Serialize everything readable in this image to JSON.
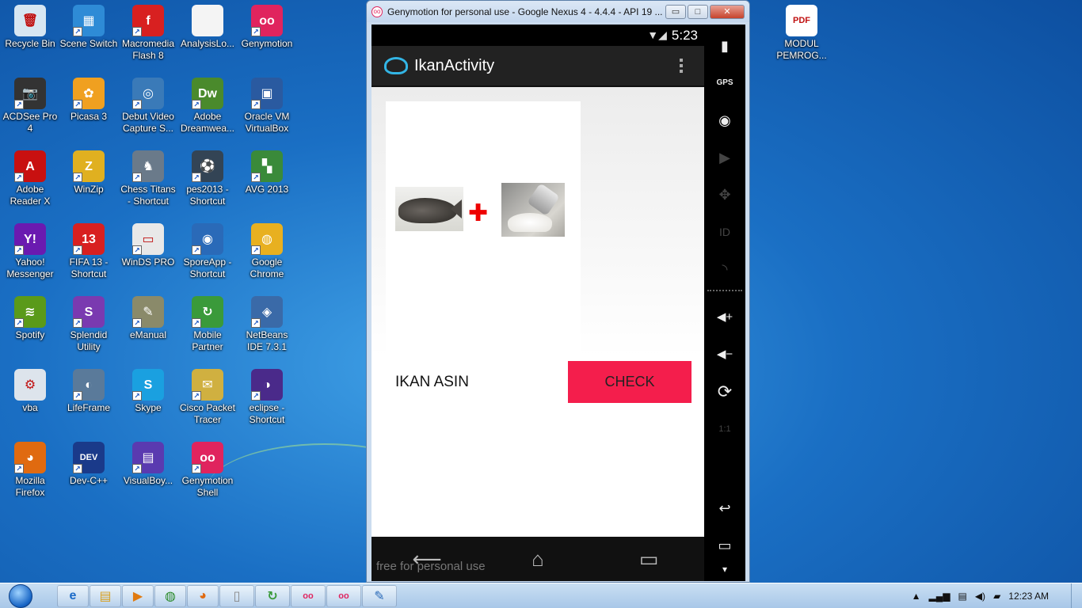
{
  "desktop": {
    "icons": [
      {
        "id": "recycle-bin",
        "label": "Recycle Bin",
        "color": "#d6e6f2",
        "glyph": "🗑",
        "shortcut": false
      },
      {
        "id": "scene-switch",
        "label": "Scene Switch",
        "color": "#2e8bd6",
        "glyph": "▦",
        "shortcut": true
      },
      {
        "id": "macromedia-flash-8",
        "label": "Macromedia Flash 8",
        "color": "#d82020",
        "glyph": "f",
        "shortcut": true
      },
      {
        "id": "analysislo",
        "label": "AnalysisLo...",
        "color": "#f4f4f4",
        "glyph": "",
        "shortcut": false
      },
      {
        "id": "genymotion",
        "label": "Genymotion",
        "color": "#e0245e",
        "glyph": "oo",
        "shortcut": true
      },
      {
        "id": "acdsee-pro-4",
        "label": "ACDSee Pro 4",
        "color": "#333333",
        "glyph": "📷",
        "shortcut": true
      },
      {
        "id": "picasa-3",
        "label": "Picasa 3",
        "color": "#f0a020",
        "glyph": "✿",
        "shortcut": true
      },
      {
        "id": "debut-video",
        "label": "Debut Video Capture S...",
        "color": "#3a7ab8",
        "glyph": "◎",
        "shortcut": true
      },
      {
        "id": "adobe-dreamweaver",
        "label": "Adobe Dreamwea...",
        "color": "#4a8a2c",
        "glyph": "Dw",
        "shortcut": true
      },
      {
        "id": "oracle-vm-virtualbox",
        "label": "Oracle VM VirtualBox",
        "color": "#2a5aa0",
        "glyph": "▣",
        "shortcut": true
      },
      {
        "id": "adobe-reader-x",
        "label": "Adobe Reader X",
        "color": "#c81010",
        "glyph": "A",
        "shortcut": true
      },
      {
        "id": "winzip",
        "label": "WinZip",
        "color": "#e0b020",
        "glyph": "Z",
        "shortcut": true
      },
      {
        "id": "chess-titans",
        "label": "Chess Titans - Shortcut",
        "color": "#6a7a8a",
        "glyph": "♞",
        "shortcut": true
      },
      {
        "id": "pes2013",
        "label": "pes2013 - Shortcut",
        "color": "#334455",
        "glyph": "⚽",
        "shortcut": true
      },
      {
        "id": "avg-2013",
        "label": "AVG 2013",
        "color": "#3a8a3a",
        "glyph": "▚",
        "shortcut": true
      },
      {
        "id": "yahoo-messenger",
        "label": "Yahoo! Messenger",
        "color": "#6a1ab0",
        "glyph": "Y!",
        "shortcut": true
      },
      {
        "id": "fifa-13",
        "label": "FIFA 13 - Shortcut",
        "color": "#d82020",
        "glyph": "13",
        "shortcut": true
      },
      {
        "id": "winds-pro",
        "label": "WinDS PRO",
        "color": "#e8e8e8",
        "glyph": "▭",
        "shortcut": true
      },
      {
        "id": "sporeapp",
        "label": "SporeApp - Shortcut",
        "color": "#2a6ab8",
        "glyph": "◉",
        "shortcut": true
      },
      {
        "id": "google-chrome",
        "label": "Google Chrome",
        "color": "#e8b020",
        "glyph": "◍",
        "shortcut": true
      },
      {
        "id": "spotify",
        "label": "Spotify",
        "color": "#5a9a1a",
        "glyph": "≋",
        "shortcut": true
      },
      {
        "id": "splendid-utility",
        "label": "Splendid Utility",
        "color": "#7a3ab0",
        "glyph": "S",
        "shortcut": true
      },
      {
        "id": "emanual",
        "label": "eManual",
        "color": "#8a8a6a",
        "glyph": "✎",
        "shortcut": true
      },
      {
        "id": "mobile-partner",
        "label": "Mobile Partner",
        "color": "#3a9a3a",
        "glyph": "↻",
        "shortcut": true
      },
      {
        "id": "netbeans-ide",
        "label": "NetBeans IDE 7.3.1",
        "color": "#3a6aa8",
        "glyph": "◈",
        "shortcut": true
      },
      {
        "id": "vba",
        "label": "vba",
        "color": "#dde4ec",
        "glyph": "⚙",
        "shortcut": false
      },
      {
        "id": "lifeframe",
        "label": "LifeFrame",
        "color": "#5a7a9a",
        "glyph": "◐",
        "shortcut": true
      },
      {
        "id": "skype",
        "label": "Skype",
        "color": "#1aa0e0",
        "glyph": "S",
        "shortcut": true
      },
      {
        "id": "cisco-packet-tracer",
        "label": "Cisco Packet Tracer",
        "color": "#d0b040",
        "glyph": "✉",
        "shortcut": true
      },
      {
        "id": "eclipse",
        "label": "eclipse - Shortcut",
        "color": "#4a2a8a",
        "glyph": "◑",
        "shortcut": true
      },
      {
        "id": "mozilla-firefox",
        "label": "Mozilla Firefox",
        "color": "#e06a10",
        "glyph": "◕",
        "shortcut": true
      },
      {
        "id": "dev-cpp",
        "label": "Dev-C++",
        "color": "#1a3a8a",
        "glyph": "DEV",
        "shortcut": true
      },
      {
        "id": "visualboy",
        "label": "VisualBoy...",
        "color": "#5a3ab0",
        "glyph": "▤",
        "shortcut": true
      },
      {
        "id": "genymotion-shell",
        "label": "Genymotion Shell",
        "color": "#e0245e",
        "glyph": "oo",
        "shortcut": true
      },
      {
        "id": "modul-pemrog",
        "label": "MODUL PEMROG...",
        "color": "#ffffff",
        "glyph": "PDF",
        "shortcut": false
      }
    ]
  },
  "emulator": {
    "window_title": "Genymotion for personal use - Google Nexus 4 - 4.4.4 - API 19 ...",
    "app_glyph": "oo",
    "minimize_label": "▭",
    "maximize_label": "□",
    "close_label": "✕",
    "status_time": "5:23",
    "status_icons": "▼◢",
    "action_bar_title": "IkanActivity",
    "answer_text": "IKAN ASIN",
    "check_label": "CHECK",
    "plus_symbol": "✚",
    "watermark": "free for personal use",
    "nav": {
      "back": "⟵",
      "home": "⌂",
      "recents": "▭"
    },
    "sidebar": {
      "battery": "▮",
      "gps": "GPS",
      "webcam": "◉",
      "capture": "▶",
      "dpad": "✥",
      "id": "ID",
      "rss": "◝",
      "volume_up": "◀+",
      "volume_down": "◀−",
      "rotate": "⟳",
      "scale": "1:1",
      "back": "↩",
      "recents": "▭",
      "menu": "▾"
    }
  },
  "taskbar": {
    "buttons": [
      {
        "id": "ie",
        "glyph": "e",
        "color": "#1a6ac8"
      },
      {
        "id": "explorer",
        "glyph": "▤",
        "color": "#d8a020"
      },
      {
        "id": "media-player",
        "glyph": "▶",
        "color": "#e07a10"
      },
      {
        "id": "chrome",
        "glyph": "◍",
        "color": "#2a8a2a"
      },
      {
        "id": "firefox",
        "glyph": "◕",
        "color": "#e06a10"
      },
      {
        "id": "notepad",
        "glyph": "▯",
        "color": "#888888"
      },
      {
        "id": "mobile-partner",
        "glyph": "↻",
        "color": "#3a9a3a"
      },
      {
        "id": "genymotion",
        "glyph": "oo",
        "color": "#e0245e"
      },
      {
        "id": "genymotion-2",
        "glyph": "oo",
        "color": "#e0245e"
      },
      {
        "id": "paint",
        "glyph": "✎",
        "color": "#2a6ab8"
      }
    ],
    "tray_up": "▲",
    "tray_signal": "▂▄▆",
    "tray_network": "▤",
    "tray_volume": "◀)",
    "tray_flag": "▰",
    "clock": "12:23 AM"
  }
}
